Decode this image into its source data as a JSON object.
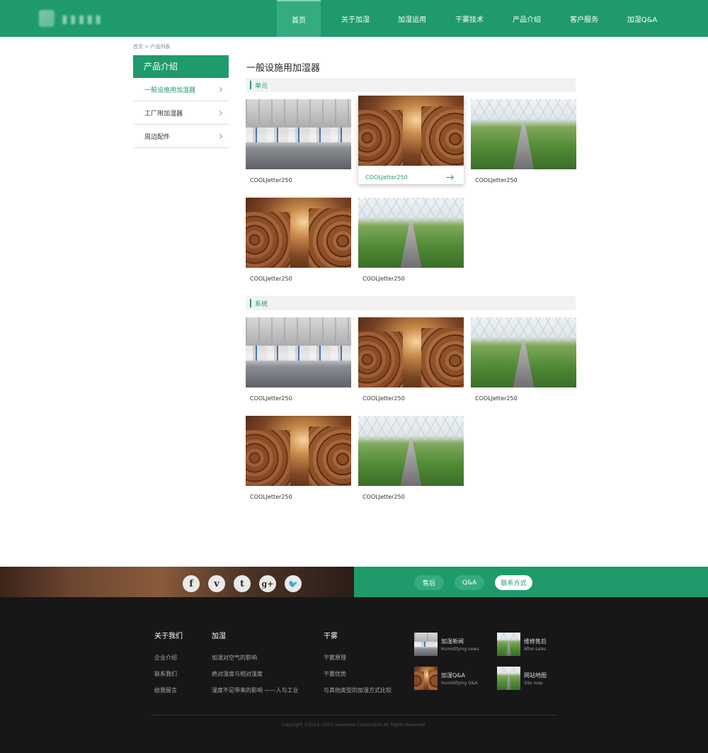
{
  "header": {
    "nav": [
      {
        "label": "首页",
        "active": true
      },
      {
        "label": "关于加湿"
      },
      {
        "label": "加湿运用"
      },
      {
        "label": "干雾技术"
      },
      {
        "label": "产品介绍"
      },
      {
        "label": "客户服务"
      },
      {
        "label": "加湿Q&A"
      }
    ]
  },
  "breadcrumb": "首页 > 产品列表",
  "sidebar": {
    "title": "产品介绍",
    "items": [
      {
        "label": "一般设施用加湿器",
        "active": true
      },
      {
        "label": "工厂用加湿器"
      },
      {
        "label": "周边配件"
      }
    ]
  },
  "main": {
    "title": "一般设施用加湿器",
    "sections": [
      {
        "label": "单元",
        "products": [
          {
            "name": "COOLJetter250",
            "image": "factory"
          },
          {
            "name": "COOLJetter250",
            "image": "cellar",
            "hover": true
          },
          {
            "name": "COOLJetter250",
            "image": "greenhouse"
          },
          {
            "name": "COOLJetter250",
            "image": "cellar"
          },
          {
            "name": "COOLJetter250",
            "image": "greenhouse"
          }
        ]
      },
      {
        "label": "系统",
        "products": [
          {
            "name": "COOLJetter250",
            "image": "factory"
          },
          {
            "name": "COOLJetter250",
            "image": "cellar"
          },
          {
            "name": "COOLJetter250",
            "image": "greenhouse"
          },
          {
            "name": "COOLJetter250",
            "image": "cellar"
          },
          {
            "name": "COOLJetter250",
            "image": "greenhouse"
          }
        ]
      }
    ]
  },
  "band": {
    "socials": [
      {
        "glyph": "f",
        "icon": "facebook-icon"
      },
      {
        "glyph": "v",
        "icon": "vimeo-icon"
      },
      {
        "glyph": "t",
        "icon": "tumblr-icon"
      },
      {
        "glyph": "g+",
        "icon": "google-plus-icon"
      },
      {
        "glyph": "🐦",
        "icon": "twitter-icon"
      }
    ],
    "buttons": [
      {
        "label": "售后"
      },
      {
        "label": "Q&A"
      },
      {
        "label": "联系方式",
        "active": true
      }
    ]
  },
  "footer": {
    "columns": [
      {
        "title": "关于我们",
        "links": [
          "企业介绍",
          "联系我们",
          "给我留言"
        ]
      },
      {
        "title": "加湿",
        "links": [
          "加湿对空气的影响",
          "绝对湿度与相对湿度",
          "湿度不足带来的影响 ——人与工业"
        ]
      },
      {
        "title": "干雾",
        "links": [
          "干雾原理",
          "干雾优势",
          "与其他类型的加湿方式比较"
        ]
      }
    ],
    "info": [
      {
        "title": "加湿新闻",
        "subtitle": "Humidifying news",
        "image": "factory"
      },
      {
        "title": "维修售后",
        "subtitle": "After-sales",
        "image": "greenhouse"
      },
      {
        "title": "加湿Q&A",
        "subtitle": "Humidifying Q&A",
        "image": "cellar"
      },
      {
        "title": "网站地图",
        "subtitle": "Site map",
        "image": "greenhouse"
      }
    ],
    "copyright": "Copyright ©2014~2015 username Corporation All Rights Reserved."
  },
  "colors": {
    "brand": "#1f9a6b",
    "footer": "#171717"
  }
}
